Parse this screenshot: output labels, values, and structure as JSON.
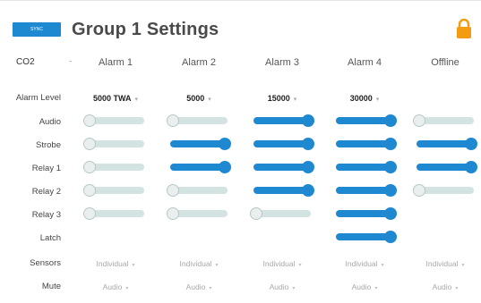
{
  "header": {
    "sync_label": "SYNC",
    "title": "Group 1 Settings"
  },
  "gas_select": {
    "value": "CO2",
    "arrow": "-"
  },
  "columns": [
    "Alarm 1",
    "Alarm 2",
    "Alarm 3",
    "Alarm 4",
    "Offline"
  ],
  "row_labels": {
    "alarm_level": "Alarm Level",
    "audio": "Audio",
    "strobe": "Strobe",
    "relay1": "Relay 1",
    "relay2": "Relay 2",
    "relay3": "Relay 3",
    "latch": "Latch",
    "sensors": "Sensors",
    "mute": "Mute"
  },
  "alarm_levels": [
    "5000 TWA",
    "5000",
    "15000",
    "30000"
  ],
  "toggles": {
    "audio": [
      false,
      false,
      true,
      true,
      false
    ],
    "strobe": [
      false,
      true,
      true,
      true,
      true
    ],
    "relay1": [
      false,
      true,
      true,
      true,
      true
    ],
    "relay2": [
      false,
      false,
      true,
      true,
      false
    ],
    "relay3": [
      false,
      false,
      false,
      true,
      null
    ],
    "latch": [
      null,
      null,
      null,
      true,
      null
    ]
  },
  "sensors": [
    "Individual",
    "Individual",
    "Individual",
    "Individual",
    "Individual"
  ],
  "mute": [
    "Audio",
    "Audio",
    "Audio",
    "Audio",
    "Audio"
  ],
  "colors": {
    "accent": "#1e88d0",
    "off_track": "#d3e3e2",
    "lock": "#f39c12"
  },
  "icons": {
    "lock": "lock-icon",
    "dropdown": "chevron-down-icon"
  }
}
